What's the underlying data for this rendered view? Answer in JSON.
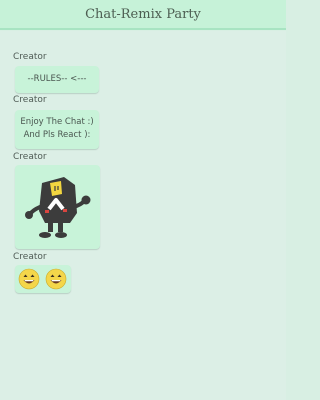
{
  "app": {
    "title": "Chat-Remix Party"
  },
  "messages": [
    {
      "sender": "Creator",
      "text": "--RULES-- <---"
    },
    {
      "sender": "Creator",
      "line1": "Enjoy The Chat :)",
      "line2": "And Pls React ):"
    },
    {
      "sender": "Creator",
      "image": "cartoon-character-sticker"
    },
    {
      "sender": "Creator",
      "emojis": [
        "grinning-face-emoji",
        "grinning-face-emoji"
      ]
    }
  ]
}
